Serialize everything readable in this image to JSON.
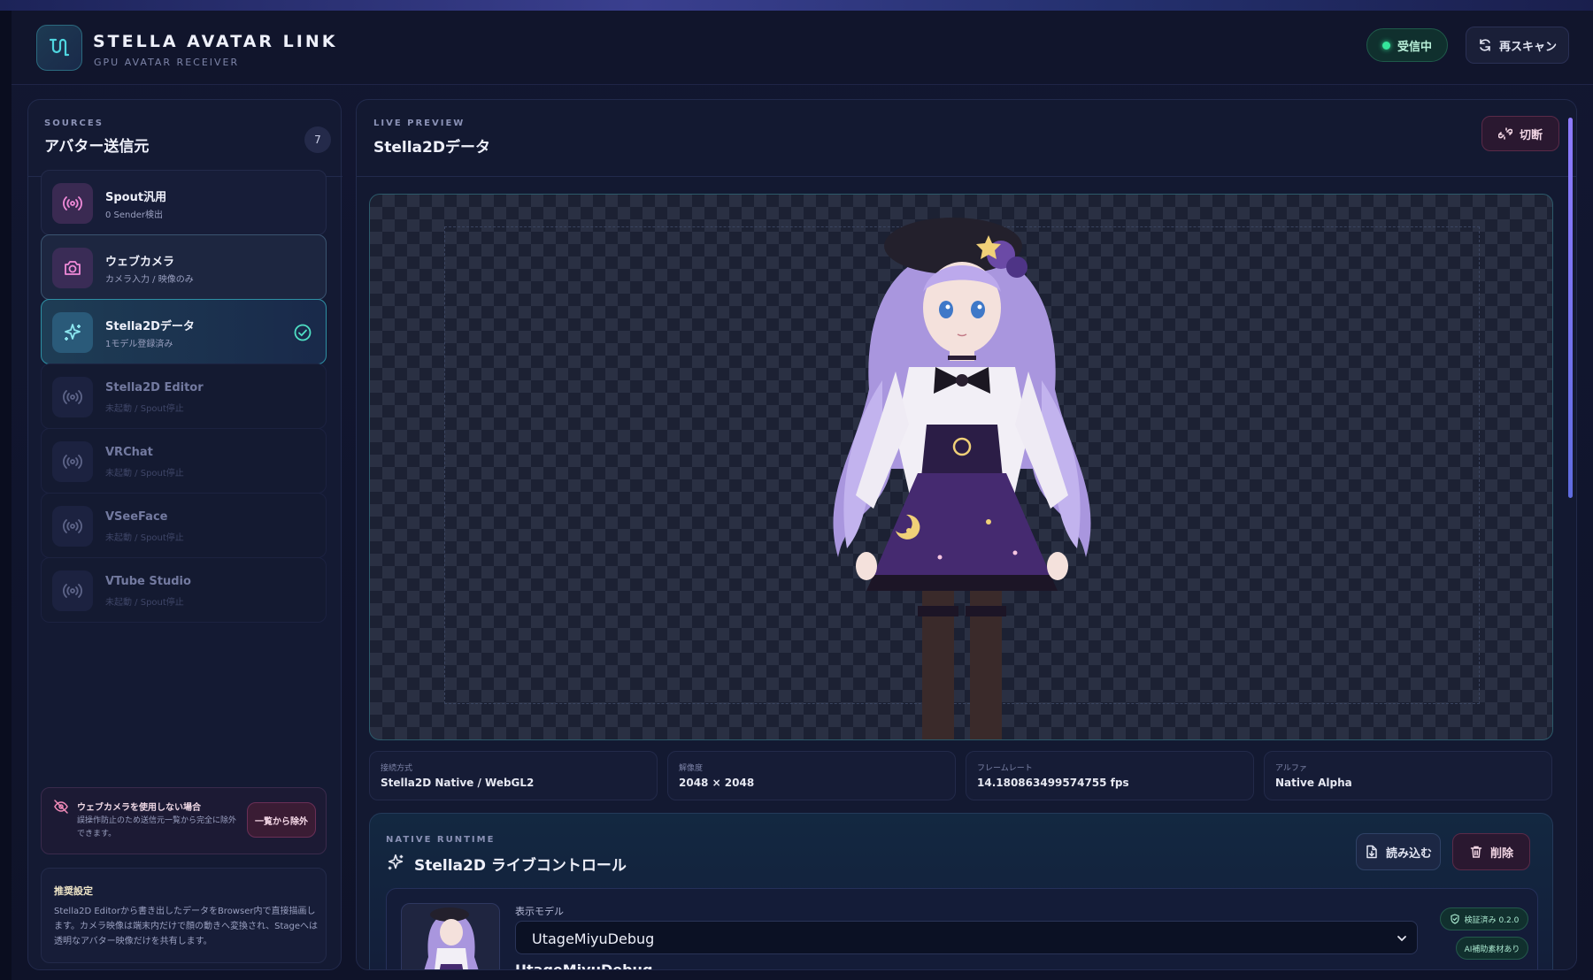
{
  "app": {
    "title": "STELLA AVATAR LINK",
    "subtitle": "GPU AVATAR RECEIVER",
    "status_label": "受信中",
    "rescan_label": "再スキャン"
  },
  "sidebar": {
    "kicker": "SOURCES",
    "title": "アバター送信元",
    "count": "7",
    "items": [
      {
        "name": "Spout汎用",
        "sub": "0 Sender検出",
        "icon": "broadcast-icon",
        "state": "normal"
      },
      {
        "name": "ウェブカメラ",
        "sub": "カメラ入力 / 映像のみ",
        "icon": "camera-icon",
        "state": "hover"
      },
      {
        "name": "Stella2Dデータ",
        "sub": "1モデル登録済み",
        "icon": "sparkle-icon",
        "state": "active"
      },
      {
        "name": "Stella2D Editor",
        "sub": "未起動 / Spout停止",
        "icon": "broadcast-icon",
        "state": "disabled"
      },
      {
        "name": "VRChat",
        "sub": "未起動 / Spout停止",
        "icon": "broadcast-icon",
        "state": "disabled"
      },
      {
        "name": "VSeeFace",
        "sub": "未起動 / Spout停止",
        "icon": "broadcast-icon",
        "state": "disabled"
      },
      {
        "name": "VTube Studio",
        "sub": "未起動 / Spout停止",
        "icon": "broadcast-icon",
        "state": "disabled"
      }
    ],
    "warning": {
      "title": "ウェブカメラを使用しない場合",
      "text": "誤操作防止のため送信元一覧から完全に除外できます。",
      "button": "一覧から除外"
    },
    "tip": {
      "title": "推奨設定",
      "text": "Stella2D Editorから書き出したデータをBrowser内で直接描画します。カメラ映像は端末内だけで顔の動きへ変換され、Stageへは透明なアバター映像だけを共有します。"
    }
  },
  "main": {
    "kicker": "LIVE PREVIEW",
    "title": "Stella2Dデータ",
    "disconnect_label": "切断",
    "stats": [
      {
        "label": "接続方式",
        "value": "Stella2D Native / WebGL2"
      },
      {
        "label": "解像度",
        "value": "2048 × 2048"
      },
      {
        "label": "フレームレート",
        "value": "14.180863499574755 fps"
      },
      {
        "label": "アルファ",
        "value": "Native Alpha"
      }
    ],
    "runtime": {
      "kicker": "NATIVE RUNTIME",
      "title": "Stella2D ライブコントロール",
      "load_label": "読み込む",
      "delete_label": "削除",
      "model_label": "表示モデル",
      "model_selected": "UtageMiyuDebug",
      "model_name": "UtageMiyuDebug",
      "badge_verified": "検証済み 0.2.0",
      "badge_ai": "AI補助素材あり"
    }
  },
  "colors": {
    "accent_teal": "#2e8fa4",
    "status_green": "#35e59b",
    "danger": "#5a2a48",
    "avatar_hair": "#b7a3e6"
  }
}
